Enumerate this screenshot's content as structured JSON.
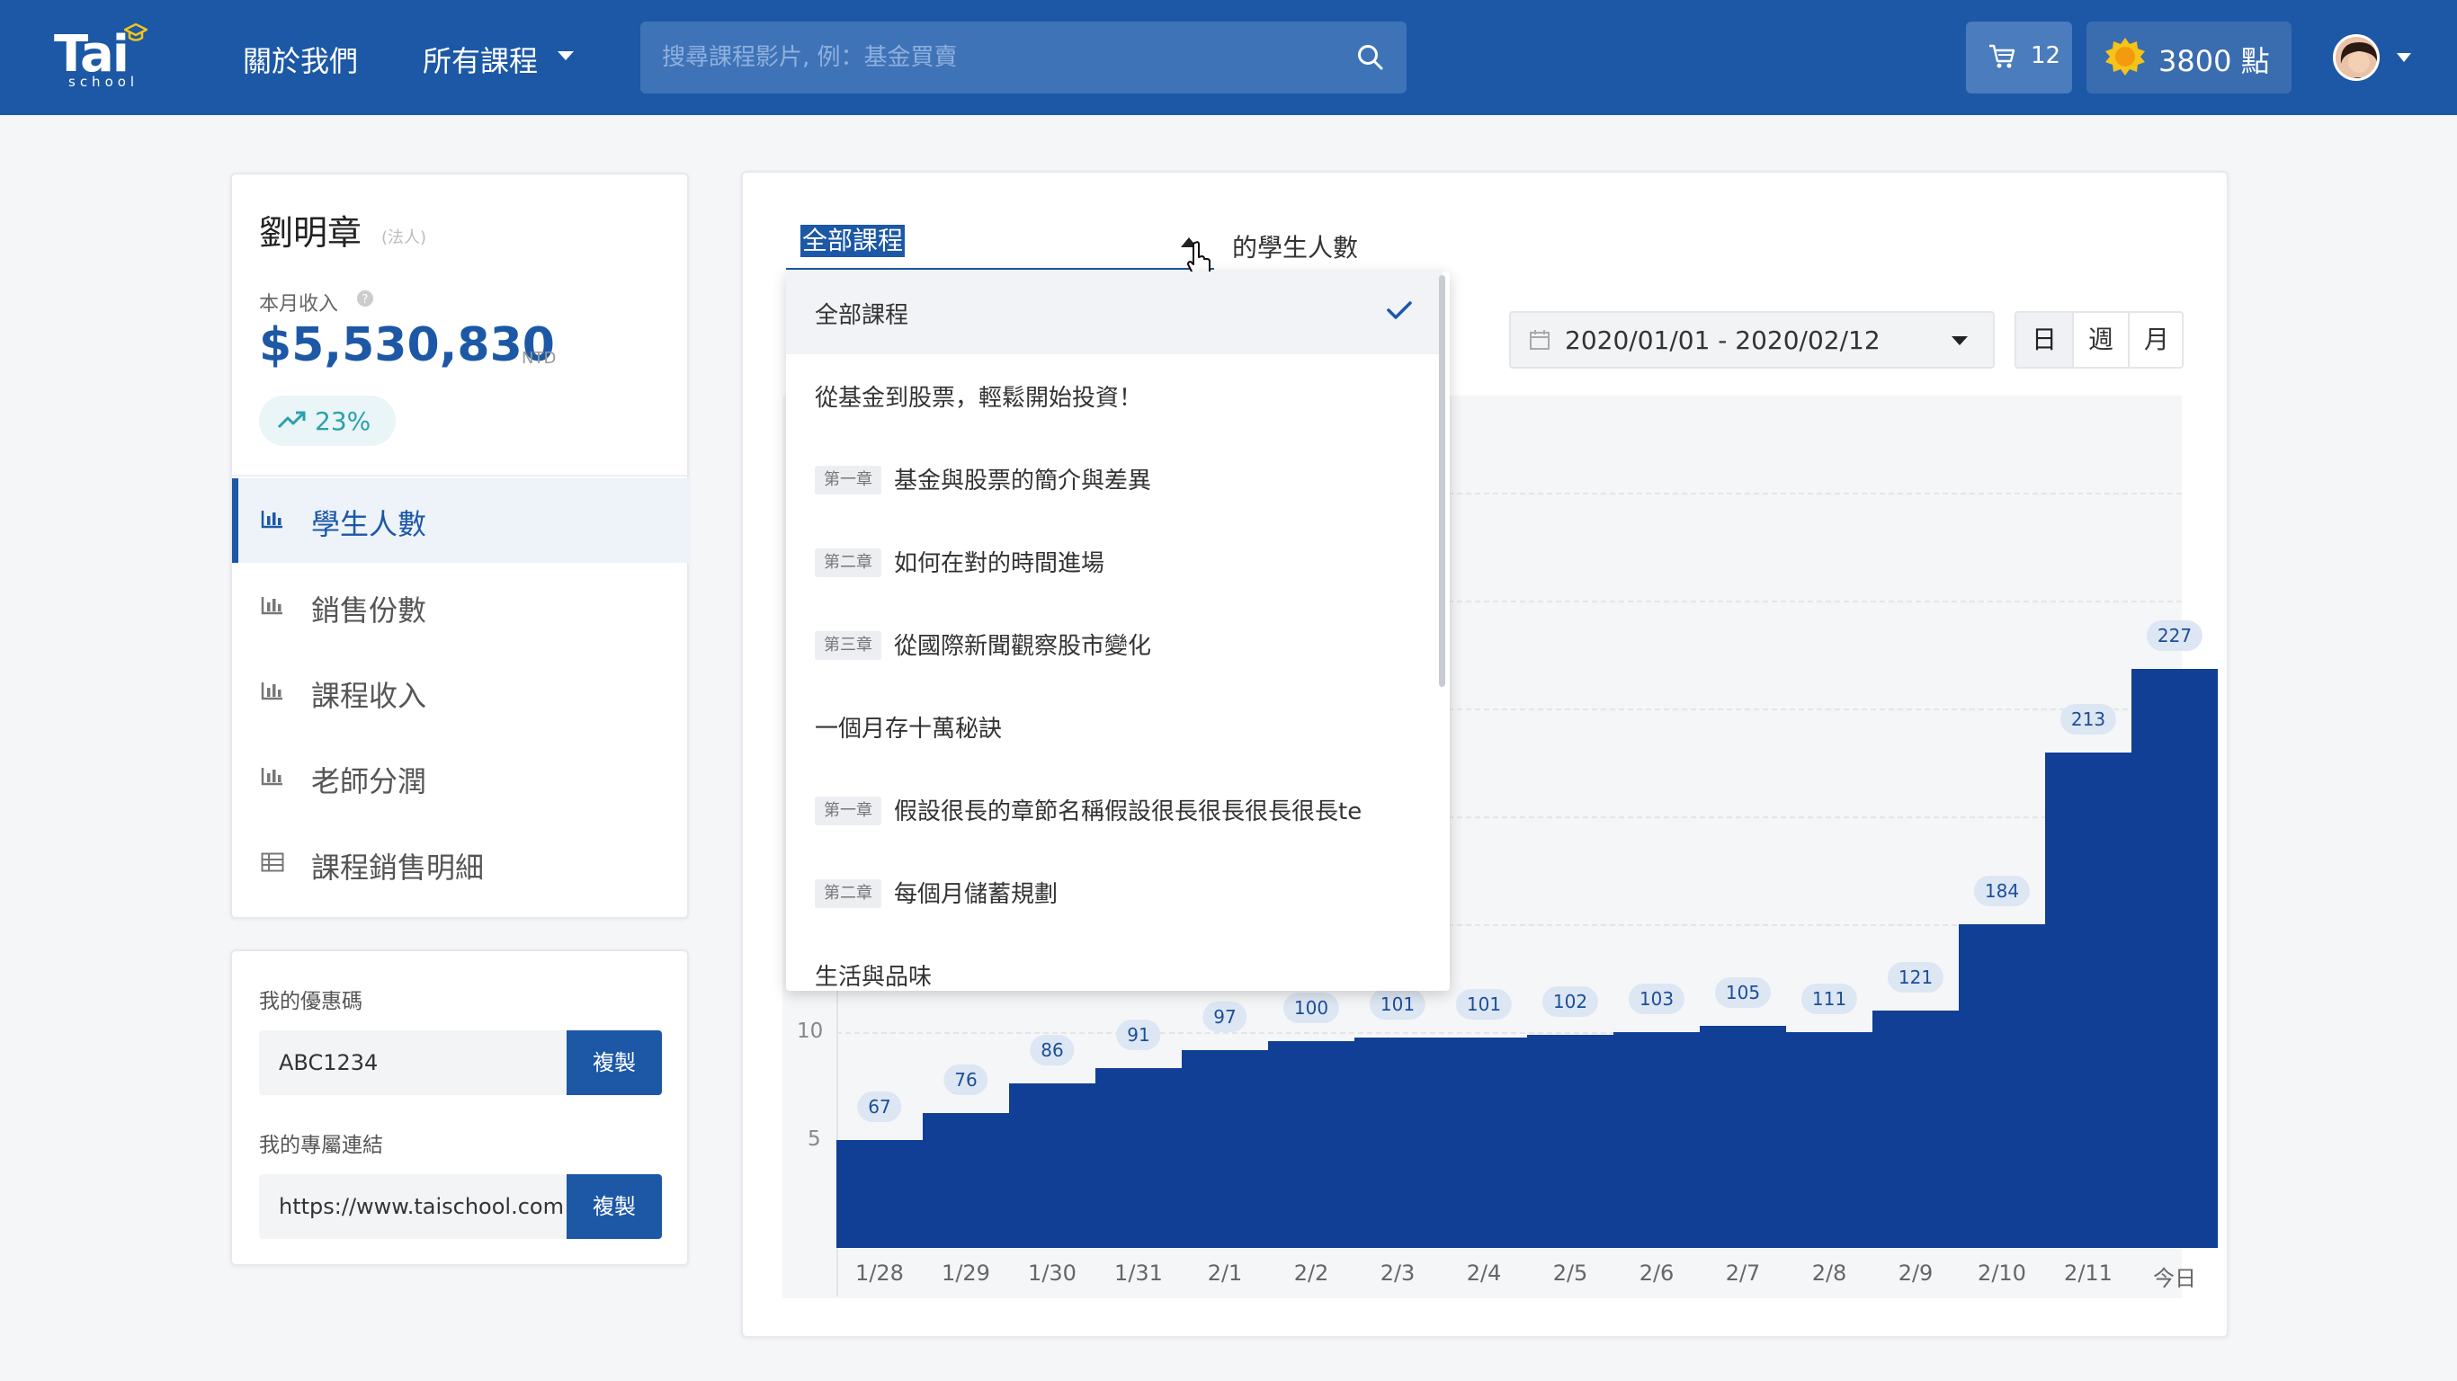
{
  "header": {
    "logo": "Tai",
    "logo_sub": "school",
    "nav_about": "關於我們",
    "nav_courses": "所有課程",
    "search_placeholder": "搜尋課程影片, 例：基金買賣",
    "cart_count": "12",
    "points": "3800 點"
  },
  "profile": {
    "name": "劉明章",
    "tag": "(法人)",
    "income_label": "本月收入",
    "income_value": "$5,530,830",
    "income_unit": "NTD",
    "growth": "23%"
  },
  "menu": [
    {
      "label": "學生人數",
      "icon": "bar-chart-icon",
      "active": true
    },
    {
      "label": "銷售份數",
      "icon": "bar-chart-icon",
      "active": false
    },
    {
      "label": "課程收入",
      "icon": "bar-chart-icon",
      "active": false
    },
    {
      "label": "老師分潤",
      "icon": "bar-chart-icon",
      "active": false
    },
    {
      "label": "課程銷售明細",
      "icon": "table-icon",
      "active": false
    }
  ],
  "coupon": {
    "code_label": "我的優惠碼",
    "code_value": "ABC1234",
    "link_label": "我的專屬連結",
    "link_value": "https://www.taischool.com",
    "copy_label": "複製"
  },
  "filter": {
    "selected": "全部課程",
    "suffix": "的學生人數",
    "date_range": "2020/01/01 - 2020/02/12",
    "period_day": "日",
    "period_week": "週",
    "period_month": "月",
    "active_period": "日"
  },
  "dropdown": {
    "options": [
      {
        "text": "全部課程",
        "selected": true
      },
      {
        "text": "從基金到股票，輕鬆開始投資！"
      },
      {
        "chapter": "第一章",
        "text": "基金與股票的簡介與差異"
      },
      {
        "chapter": "第二章",
        "text": "如何在對的時間進場"
      },
      {
        "chapter": "第三章",
        "text": "從國際新聞觀察股市變化"
      },
      {
        "text": "一個月存十萬秘訣"
      },
      {
        "chapter": "第一章",
        "text": "假設很長的章節名稱假設很長很長很長很長te"
      },
      {
        "chapter": "第二章",
        "text": "每個月儲蓄規劃"
      },
      {
        "text": "生活與品味"
      }
    ]
  },
  "chart_data": {
    "type": "bar",
    "categories": [
      "1/28",
      "1/29",
      "1/30",
      "1/31",
      "2/1",
      "2/2",
      "2/3",
      "2/4",
      "2/5",
      "2/6",
      "2/7",
      "2/8",
      "2/9",
      "2/10",
      "2/11",
      "今日"
    ],
    "values": [
      67,
      76,
      86,
      91,
      97,
      100,
      101,
      101,
      102,
      103,
      105,
      111,
      121,
      184,
      213,
      227
    ],
    "visible_y_ticks": [
      "10",
      "5"
    ],
    "bar_color": "#103f95",
    "grid": true
  },
  "colors": {
    "brand": "#1c58a6",
    "bar": "#103f95"
  }
}
